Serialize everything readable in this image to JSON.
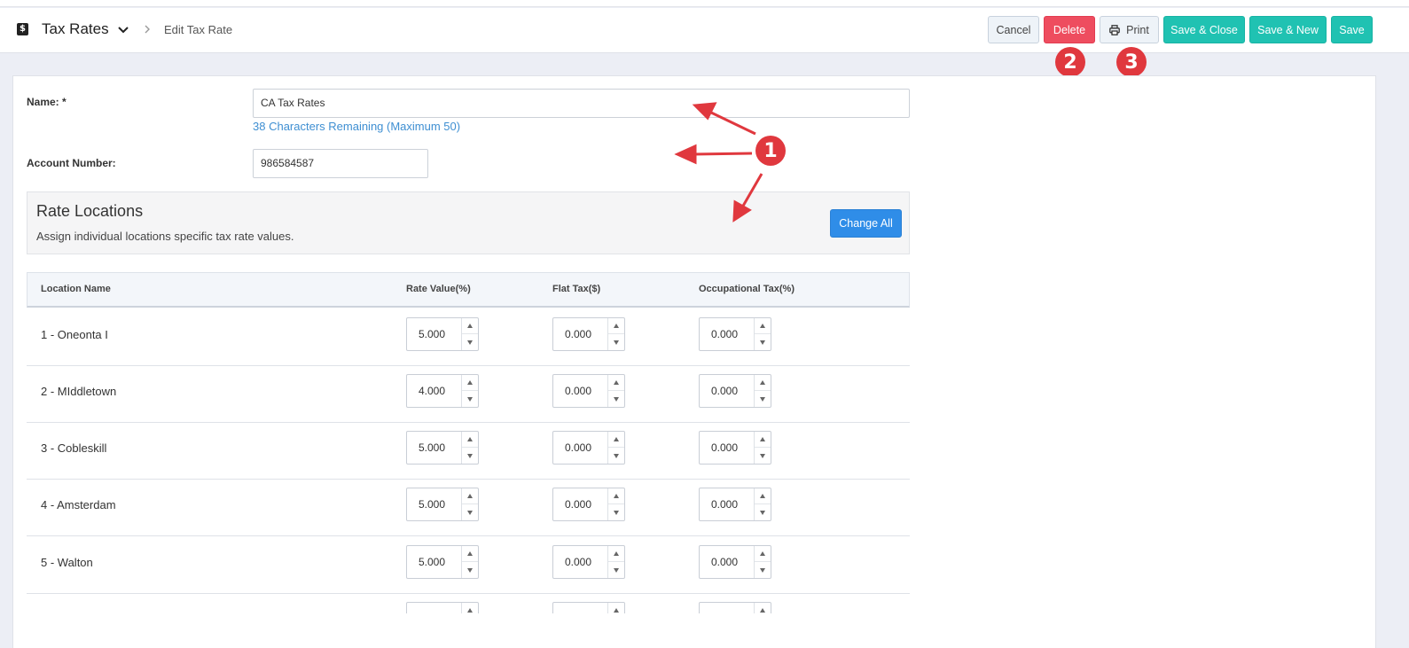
{
  "header": {
    "title": "Tax Rates",
    "breadcrumb_current": "Edit Tax Rate",
    "app_icon_glyph": "$"
  },
  "toolbar": {
    "cancel": "Cancel",
    "delete": "Delete",
    "print": "Print",
    "save_close": "Save & Close",
    "save_new": "Save & New",
    "save": "Save"
  },
  "annotations": {
    "badge1": "1",
    "badge2": "2",
    "badge3": "3",
    "color": "#e0383e"
  },
  "form": {
    "name_label": "Name: *",
    "name_value": "CA Tax Rates",
    "chars_remaining": "38 Characters Remaining (Maximum 50)",
    "account_label": "Account Number:",
    "account_value": "986584587"
  },
  "rate_locations": {
    "title": "Rate Locations",
    "description": "Assign individual locations specific tax rate values.",
    "change_all": "Change All"
  },
  "table": {
    "headers": {
      "location": "Location Name",
      "rate": "Rate Value(%)",
      "flat": "Flat Tax($)",
      "occupational": "Occupational Tax(%)"
    },
    "rows": [
      {
        "location": "1 - Oneonta I",
        "rate": "5.000",
        "flat": "0.000",
        "occupational": "0.000"
      },
      {
        "location": "2 - MIddletown",
        "rate": "4.000",
        "flat": "0.000",
        "occupational": "0.000"
      },
      {
        "location": "3 - Cobleskill",
        "rate": "5.000",
        "flat": "0.000",
        "occupational": "0.000"
      },
      {
        "location": "4 - Amsterdam",
        "rate": "5.000",
        "flat": "0.000",
        "occupational": "0.000"
      },
      {
        "location": "5 - Walton",
        "rate": "5.000",
        "flat": "0.000",
        "occupational": "0.000"
      },
      {
        "location": "",
        "rate": "",
        "flat": "",
        "occupational": ""
      }
    ]
  },
  "colors": {
    "delete": "#ee4d5f",
    "teal": "#20c2b2",
    "primary_blue": "#2f8de8",
    "link_blue": "#3f8fd2"
  }
}
